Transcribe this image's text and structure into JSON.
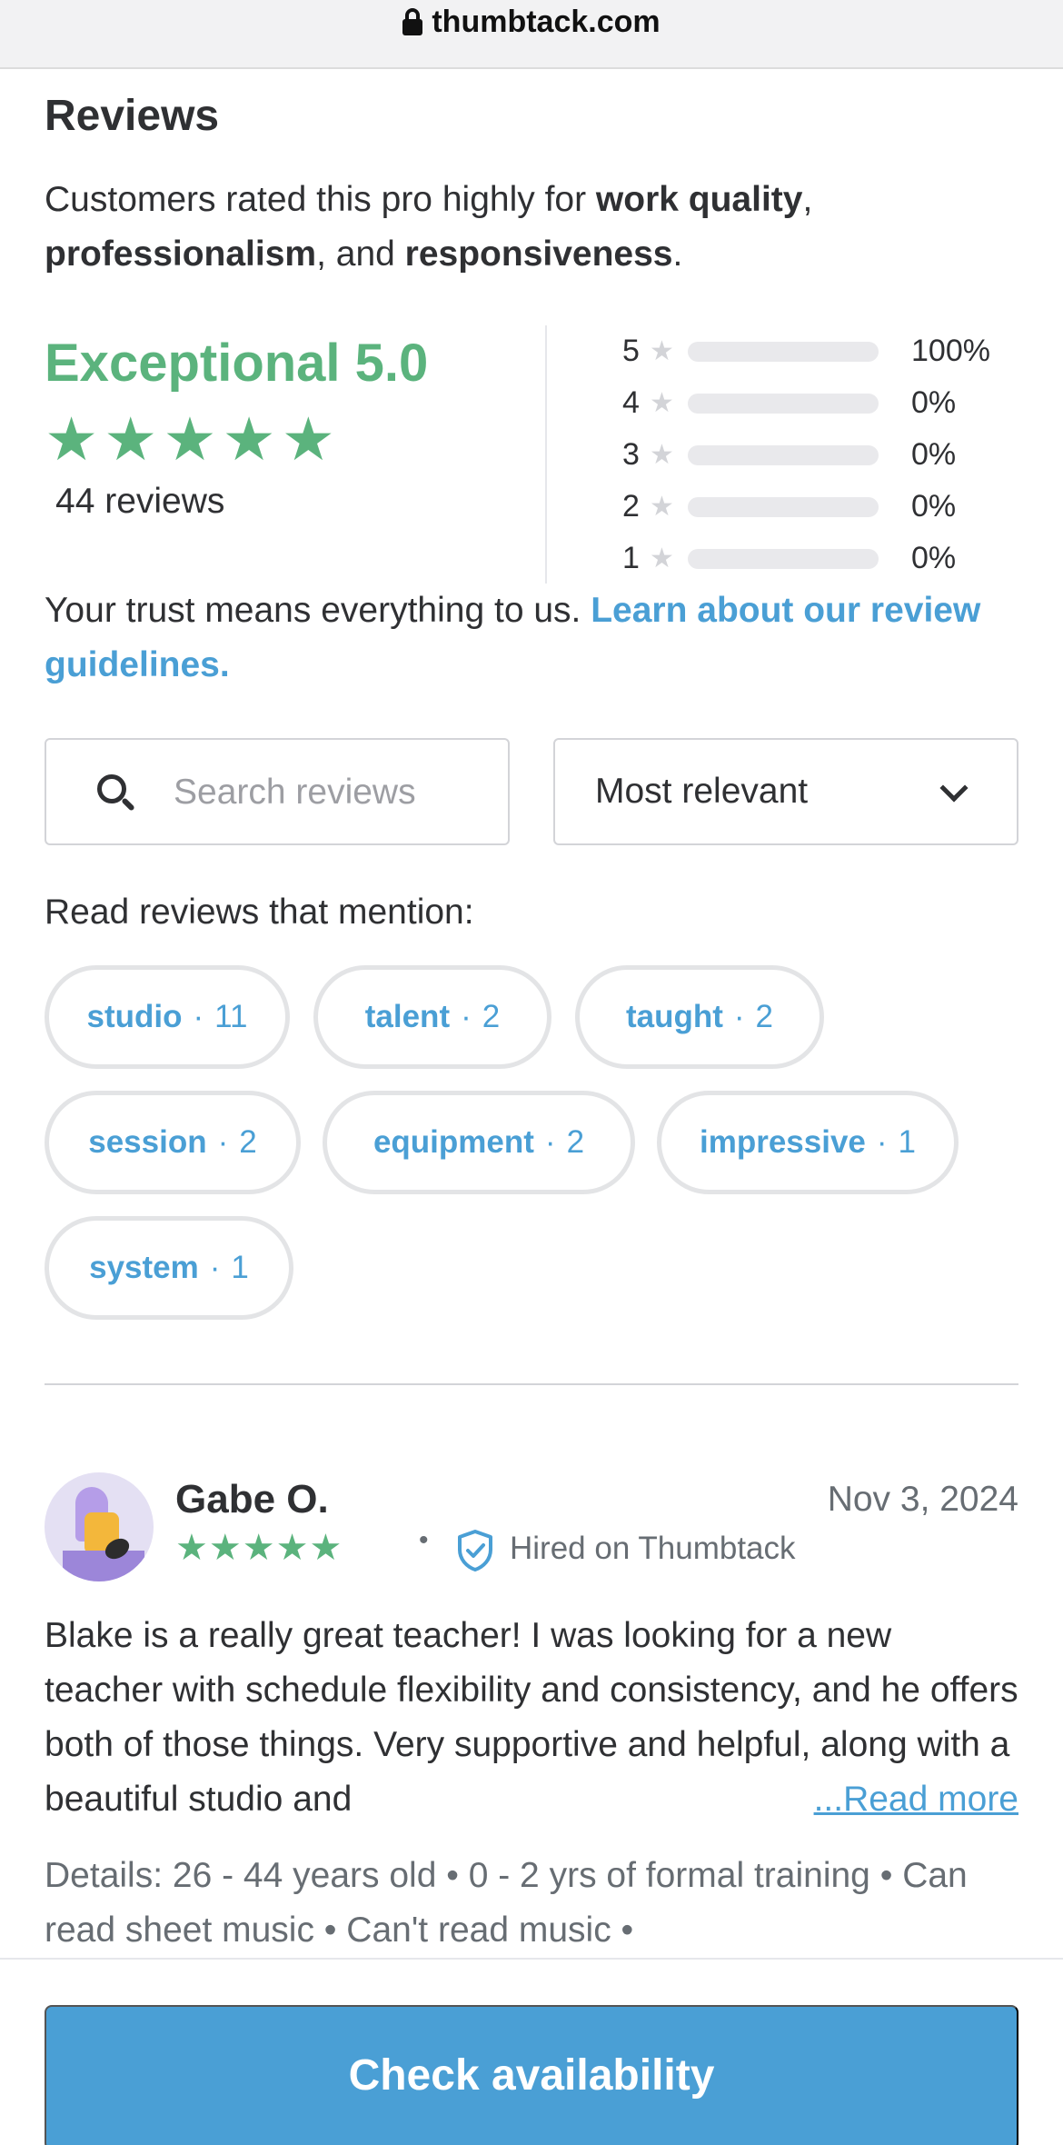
{
  "browser": {
    "url": "thumbtack.com"
  },
  "reviews": {
    "heading": "Reviews",
    "summary_prefix": "Customers rated this pro highly for ",
    "summary_bold_1": "work quality",
    "summary_sep_1": ", ",
    "summary_bold_2": "professionalism",
    "summary_sep_2": ", and ",
    "summary_bold_3": "responsiveness",
    "summary_end": ".",
    "rating_label": "Exceptional 5.0",
    "rating_value": 5.0,
    "stars": "★★★★★",
    "review_count": "44 reviews",
    "star_glyph": "★",
    "distribution": [
      {
        "stars": "5",
        "percent_label": "100%",
        "fraction": 1.0
      },
      {
        "stars": "4",
        "percent_label": "0%",
        "fraction": 0
      },
      {
        "stars": "3",
        "percent_label": "0%",
        "fraction": 0
      },
      {
        "stars": "2",
        "percent_label": "0%",
        "fraction": 0
      },
      {
        "stars": "1",
        "percent_label": "0%",
        "fraction": 0
      }
    ],
    "trust_text": "Your trust means everything to us. ",
    "trust_link": "Learn about our review guidelines."
  },
  "search": {
    "placeholder": "Search reviews",
    "value": ""
  },
  "sort": {
    "selected": "Most relevant"
  },
  "mentions": {
    "label": "Read reviews that mention:",
    "dot": "·",
    "pills": [
      {
        "label": "studio",
        "count": "11"
      },
      {
        "label": "talent",
        "count": "2"
      },
      {
        "label": "taught",
        "count": "2"
      },
      {
        "label": "session",
        "count": "2"
      },
      {
        "label": "equipment",
        "count": "2"
      },
      {
        "label": "impressive",
        "count": "1"
      },
      {
        "label": "system",
        "count": "1"
      }
    ]
  },
  "review": {
    "name": "Gabe O.",
    "date": "Nov 3, 2024",
    "rating": 5,
    "stars": "★★★★★",
    "separator": "•",
    "hired_label": "Hired on Thumbtack",
    "text": "Blake is a really great teacher! I was looking for a new teacher with schedule flexibility and consistency, and he offers both of those things. Very supportive and helpful, along with a beautiful studio and",
    "read_more": "...Read more",
    "details": "Details: 26 - 44 years old • 0 - 2 yrs of formal training • Can read sheet music • Can't read music •"
  },
  "cta": {
    "label": "Check availability"
  },
  "colors": {
    "accent_green": "#5bb37d",
    "link_blue": "#4a9fd5",
    "text": "#2f3033"
  }
}
